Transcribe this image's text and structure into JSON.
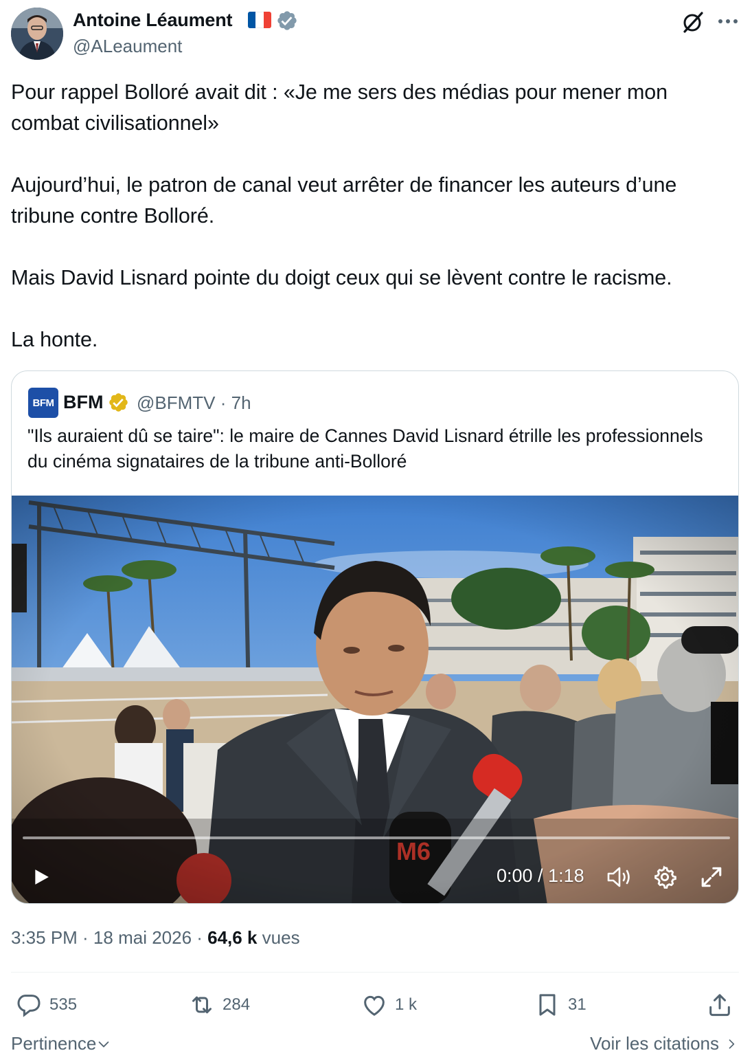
{
  "author": {
    "name": "Antoine Léaument",
    "handle": "@ALeaument",
    "flag_colors": [
      "#0055a4",
      "#ffffff",
      "#ef4135"
    ],
    "verified_color": "#829aab"
  },
  "tweet": {
    "paragraphs": [
      "Pour rappel Bolloré avait dit  : «Je me sers des médias pour mener mon combat civilisationnel»",
      "Aujourd’hui, le patron de canal veut arrêter de financer les auteurs d’une tribune contre Bolloré.",
      "Mais David Lisnard pointe du doigt ceux qui se lèvent contre le racisme.",
      "La honte."
    ]
  },
  "quote": {
    "logo_text": "BFM",
    "name": "BFM",
    "handle_time": "@BFMTV · 7h",
    "text": "\"Ils auraient dû se taire\": le maire de Cannes David Lisnard étrille les professionnels du cinéma signataires de la tribune anti-Bolloré",
    "badge_color": "#e2b719",
    "video": {
      "time": "0:00 / 1:18",
      "progress": 0.0
    }
  },
  "meta": {
    "time": "3:35 PM · 18 mai 2026 · ",
    "views": "64,6 k",
    "views_label": " vues"
  },
  "actions": {
    "replies": "535",
    "reposts": "284",
    "likes": "1 k",
    "bookmarks": "31"
  },
  "footer": {
    "sort": "Pertinence",
    "quotes_link": "Voir les citations"
  },
  "icons": [
    "grok-icon",
    "more-icon",
    "verified-icon",
    "play-icon",
    "volume-icon",
    "gear-icon",
    "fullscreen-icon",
    "reply-icon",
    "repost-icon",
    "like-icon",
    "bookmark-icon",
    "share-icon",
    "chevron-down-icon",
    "chevron-right-icon"
  ]
}
